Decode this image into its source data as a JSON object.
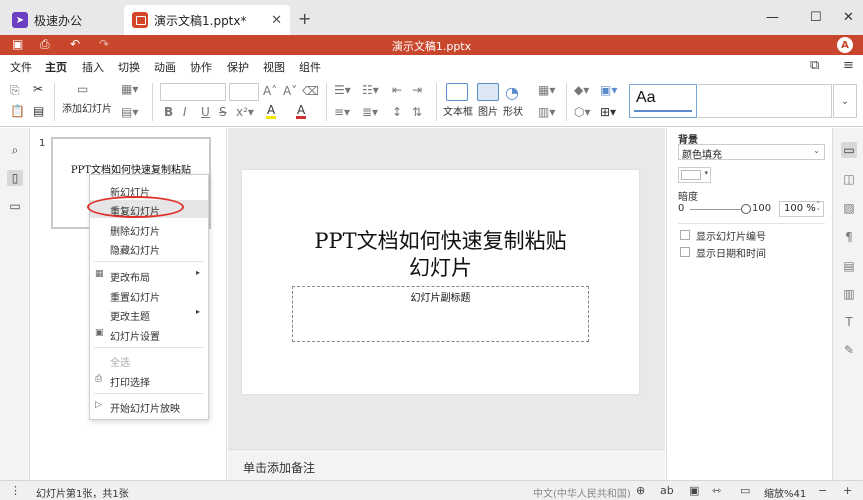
{
  "tabs": {
    "app_label": "极速办公",
    "doc_label": "演示文稿1.pptx*",
    "close_glyph": "✕",
    "new_tab_glyph": "+"
  },
  "window": {
    "minimize_glyph": "—",
    "maximize_glyph": "☐",
    "close_glyph": "✕"
  },
  "titlebar": {
    "title": "演示文稿1.pptx",
    "user_initial": "A"
  },
  "menu": {
    "items": [
      "文件",
      "主页",
      "插入",
      "切换",
      "动画",
      "协作",
      "保护",
      "视图",
      "组件"
    ],
    "active": "主页"
  },
  "ribbon": {
    "add_slide_label": "添加幻灯片",
    "textbox_label": "文本框",
    "picture_label": "图片",
    "shape_label": "形状",
    "style_preview": "Aa",
    "font_buttons": [
      "B",
      "I",
      "U",
      "S"
    ],
    "grow_font": "A˄",
    "shrink_font": "A˅",
    "highlight": "A",
    "font_color": "A"
  },
  "thumbnails": {
    "slide_number": "1",
    "slide_title": "PPT文档如何快速复制粘贴"
  },
  "context_menu": {
    "items": [
      {
        "label": "新幻灯片",
        "icon": "",
        "submenu": false,
        "disabled": false,
        "highlighted": false
      },
      {
        "label": "重复幻灯片",
        "icon": "",
        "submenu": false,
        "disabled": false,
        "highlighted": true
      },
      {
        "label": "删除幻灯片",
        "icon": "",
        "submenu": false,
        "disabled": false,
        "highlighted": false
      },
      {
        "label": "隐藏幻灯片",
        "icon": "",
        "submenu": false,
        "disabled": false,
        "highlighted": false
      },
      {
        "label": "更改布局",
        "icon": "layout-icon",
        "submenu": true,
        "disabled": false,
        "highlighted": false
      },
      {
        "label": "重置幻灯片",
        "icon": "",
        "submenu": false,
        "disabled": false,
        "highlighted": false
      },
      {
        "label": "更改主题",
        "icon": "",
        "submenu": true,
        "disabled": false,
        "highlighted": false
      },
      {
        "label": "幻灯片设置",
        "icon": "slide-settings-icon",
        "submenu": false,
        "disabled": false,
        "highlighted": false
      },
      {
        "label": "全选",
        "icon": "",
        "submenu": false,
        "disabled": true,
        "highlighted": false
      },
      {
        "label": "打印选择",
        "icon": "print-icon",
        "submenu": false,
        "disabled": false,
        "highlighted": false
      },
      {
        "label": "开始幻灯片放映",
        "icon": "slideshow-icon",
        "submenu": false,
        "disabled": false,
        "highlighted": false
      }
    ]
  },
  "slide": {
    "title_line1": "PPT文档如何快速复制粘贴",
    "title_line2": "幻灯片",
    "subtitle": "幻灯片副标题"
  },
  "notes": {
    "placeholder": "单击添加备注"
  },
  "properties": {
    "background_label": "背景",
    "fill_type": "颜色填充",
    "fill_color": "#ffffff",
    "opacity_label": "暗度",
    "opacity_min": "0",
    "opacity_max": "100",
    "opacity_value": "100 %",
    "opacity_fraction": 1.0,
    "show_slide_number": "显示幻灯片编号",
    "show_date_time": "显示日期和时间"
  },
  "statusbar": {
    "slide_info": "幻灯片第1张，共1张",
    "language": "中文(中华人民共和国)",
    "zoom": "缩放%41"
  },
  "colors": {
    "accent": "#c8462b",
    "highlight_ring": "#e0302a"
  }
}
